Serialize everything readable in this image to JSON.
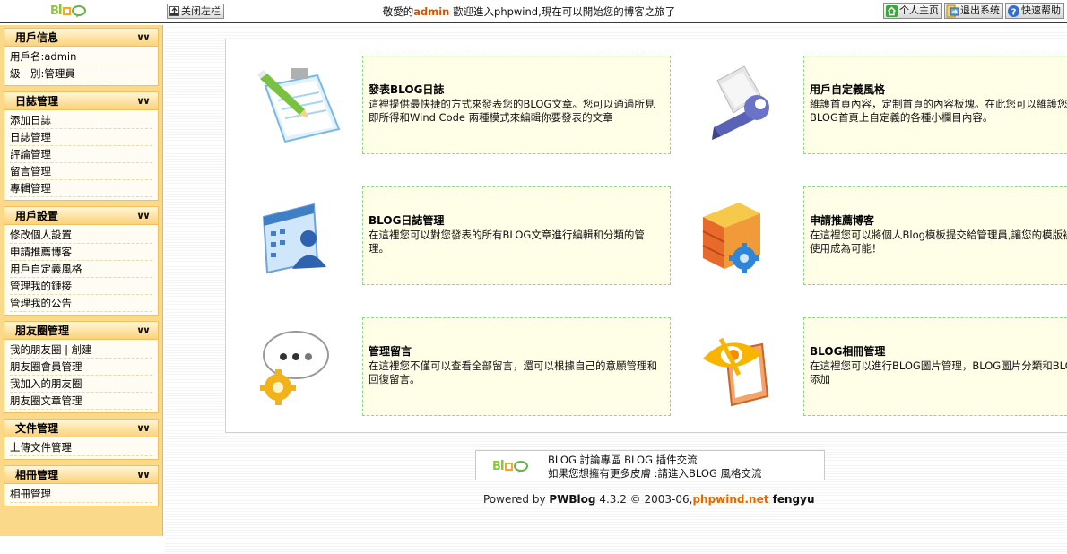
{
  "topbar": {
    "logo_text": "Blog",
    "toggle_label": "关闭左栏",
    "welcome_prefix": "敬愛的",
    "username": "admin",
    "welcome_suffix": " 歡迎進入phpwind,現在可以開始您的博客之旅了",
    "actions": [
      {
        "label": "个人主页",
        "icon": "home-icon"
      },
      {
        "label": "退出系统",
        "icon": "logout-icon"
      },
      {
        "label": "快速帮助",
        "icon": "help-icon"
      }
    ]
  },
  "sidebar": {
    "collapse_icon": "double-chevron-down-icon",
    "panels": [
      {
        "title": "用戶信息",
        "items": [
          "用戶名:admin",
          "級　別:管理員"
        ]
      },
      {
        "title": "日誌管理",
        "items": [
          "添加日誌",
          "日誌管理",
          "評論管理",
          "留言管理",
          "專輯管理"
        ]
      },
      {
        "title": "用戶設置",
        "items": [
          "修改個人設置",
          "申請推薦博客",
          "用戶自定義風格",
          "管理我的鏈接",
          "管理我的公告"
        ]
      },
      {
        "title": "朋友圈管理",
        "items": [
          "我的朋友圈 | 創建",
          "朋友圈會員管理",
          "我加入的朋友圈",
          "朋友圈文章管理"
        ]
      },
      {
        "title": "文件管理",
        "items": [
          "上傳文件管理"
        ]
      },
      {
        "title": "相冊管理",
        "items": [
          "相冊管理"
        ]
      }
    ]
  },
  "features": [
    {
      "title": "發表BLOG日誌",
      "desc": "這裡提供最快捷的方式來發表您的BLOG文章。您可以通過所見即所得和Wind Code 兩種模式來編輯你要發表的文章",
      "icon": "notepad-pencil-icon"
    },
    {
      "title": "用戶自定義風格",
      "desc": "維護首頁內容，定制首頁的內容板塊。在此您可以維護您在個人BLOG首頁上自定義的各種小欄目內容。",
      "icon": "wrench-document-icon"
    },
    {
      "title": "BLOG日誌管理",
      "desc": "在這裡您可以對您發表的所有BLOG文章進行編輯和分類的管理。",
      "icon": "user-list-window-icon"
    },
    {
      "title": "申請推薦博客",
      "desc": "在這裡您可以將個人Blog模板提交給管理員,讓您的模版被數萬人使用成為可能！",
      "icon": "server-gear-icon"
    },
    {
      "title": "管理留言",
      "desc": "在這裡您不僅可以查看全部留言，還可以根據自己的意願管理和回復留言。",
      "icon": "speech-bubble-gear-icon"
    },
    {
      "title": "BLOG相冊管理",
      "desc": "在這裡您可以進行BLOG圖片管理，BLOG圖片分類和BLOG圖片添加",
      "icon": "eye-picture-frame-icon"
    }
  ],
  "footer": {
    "logo_text": "Blog",
    "line1": "BLOG 討論專區 BLOG 插件交流",
    "line2": "如果您想擁有更多皮膚 :請進入BLOG 風格交流",
    "powered_prefix": "Powered by ",
    "product": "PWBlog",
    "version": " 4.3.2 © 2003-06,",
    "site": "phpwind.net",
    "author": " fengyu"
  },
  "colors": {
    "sidebar_bg": "#fbd98a",
    "card_bg": "#ffffe8",
    "card_border": "#8fd48f",
    "username_accent": "#d35400",
    "site_accent": "#e06a00"
  }
}
